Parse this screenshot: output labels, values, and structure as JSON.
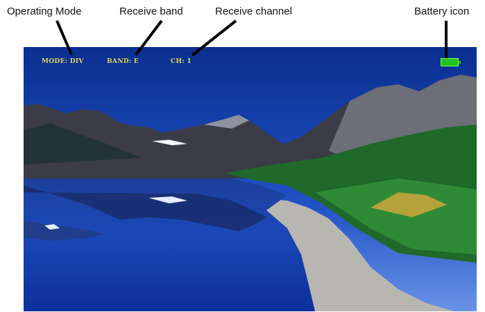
{
  "callouts": {
    "operating_mode": "Operating Mode",
    "receive_band": "Receive band",
    "receive_channel": "Receive channel",
    "battery_icon": "Battery  icon"
  },
  "osd": {
    "mode": "MODE: DIV",
    "band": "BAND: E",
    "channel": "CH: 1",
    "battery_icon": "battery-icon",
    "battery_color": "#22c21f"
  },
  "colors": {
    "osd_text": "#e6d35a",
    "sky": "#0b3f9a"
  }
}
